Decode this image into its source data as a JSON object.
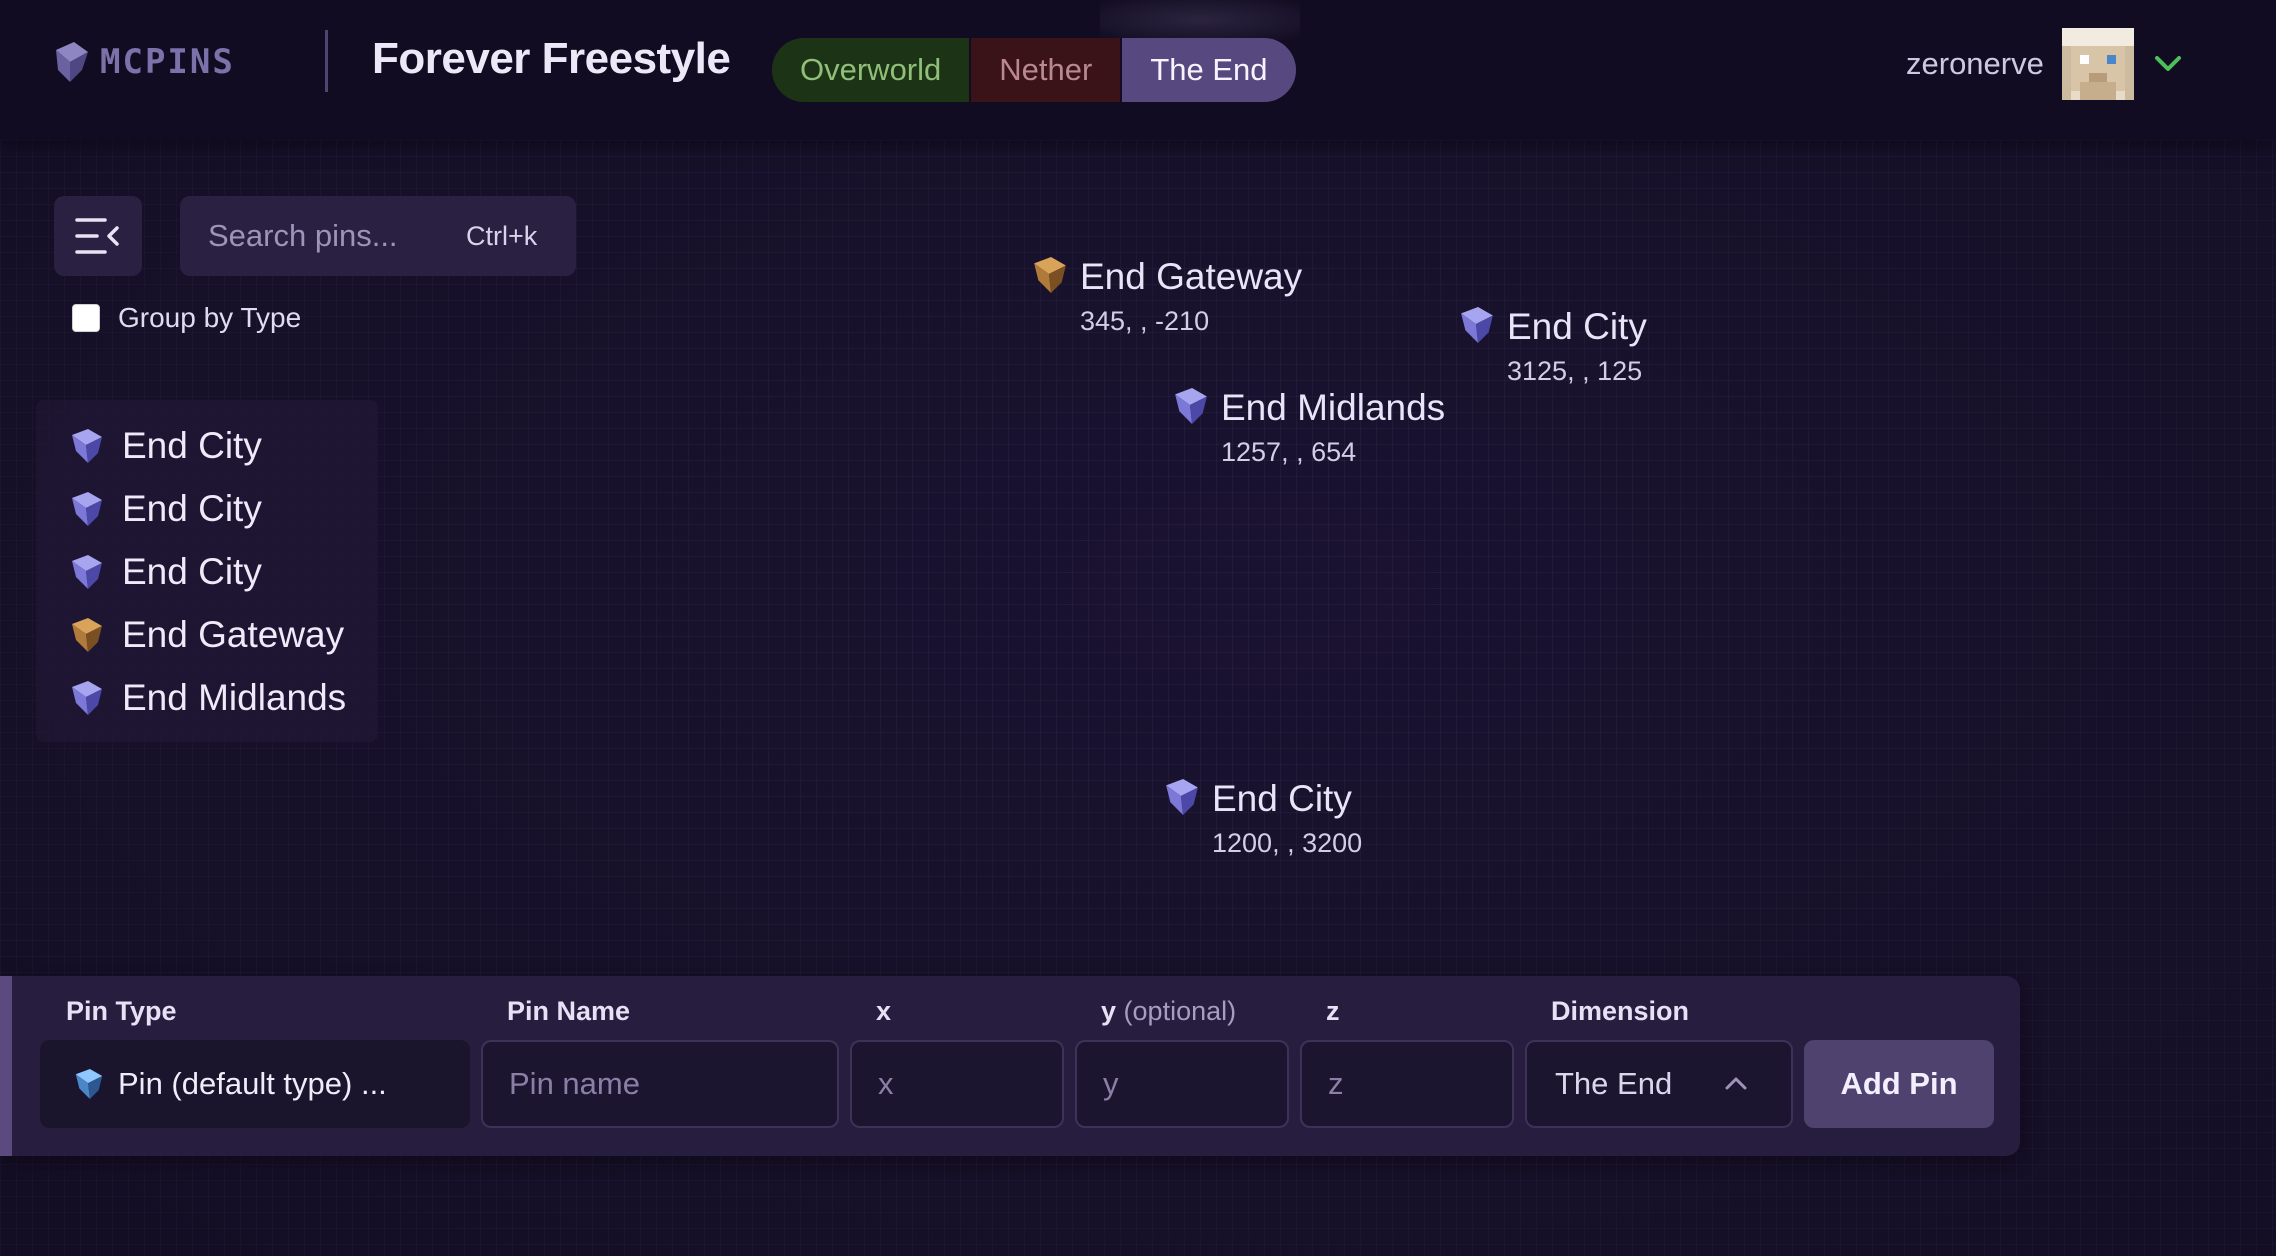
{
  "header": {
    "logo_text": "MCPINS",
    "server_title": "Forever Freestyle",
    "dimension_tabs": [
      {
        "label": "Overworld",
        "active": false,
        "color": "#8fbf78"
      },
      {
        "label": "Nether",
        "active": false,
        "color": "#b98890"
      },
      {
        "label": "The End",
        "active": true,
        "color": "#f7f4ff"
      }
    ],
    "username": "zeronerve",
    "user_menu_icon": "chevron-down-icon",
    "user_menu_icon_color": "#4cbf5a"
  },
  "sidebar": {
    "toggle_icon": "collapse-sidebar-icon",
    "search": {
      "placeholder": "Search pins...",
      "value": "",
      "shortcut": "Ctrl+k"
    },
    "group_by_type": {
      "label": "Group by Type",
      "checked": false
    },
    "pins": [
      {
        "label": "End City",
        "icon": "end-city-gem-icon"
      },
      {
        "label": "End City",
        "icon": "end-city-gem-icon"
      },
      {
        "label": "End City",
        "icon": "end-city-gem-icon"
      },
      {
        "label": "End Gateway",
        "icon": "end-gateway-gem-icon"
      },
      {
        "label": "End Midlands",
        "icon": "end-city-gem-icon"
      }
    ]
  },
  "map": {
    "pins": [
      {
        "name": "End Gateway",
        "coords": "345, , -210",
        "color": "#b07a3a"
      },
      {
        "name": "End City",
        "coords": "3125, , 125",
        "color": "#7b78d8"
      },
      {
        "name": "End Midlands",
        "coords": "1257, , 654",
        "color": "#7b78d8"
      },
      {
        "name": "End City",
        "coords": "1200, , 3200",
        "color": "#7b78d8"
      }
    ]
  },
  "add_pin_form": {
    "pin_type": {
      "label": "Pin Type",
      "value": "Pin (default type) ...",
      "icon": "pin-default-gem-icon"
    },
    "pin_name": {
      "label": "Pin Name",
      "placeholder": "Pin name",
      "value": ""
    },
    "x": {
      "label": "x",
      "placeholder": "x",
      "value": ""
    },
    "y": {
      "label": "y",
      "optional_note": "(optional)",
      "placeholder": "y",
      "value": ""
    },
    "z": {
      "label": "z",
      "placeholder": "z",
      "value": ""
    },
    "dimension": {
      "label": "Dimension",
      "value": "The End"
    },
    "submit_label": "Add Pin"
  },
  "colors": {
    "background": "#150f25",
    "accent": "#57497f",
    "end_city_gem": "#7b78d8",
    "end_gateway_gem": "#b07a3a"
  }
}
